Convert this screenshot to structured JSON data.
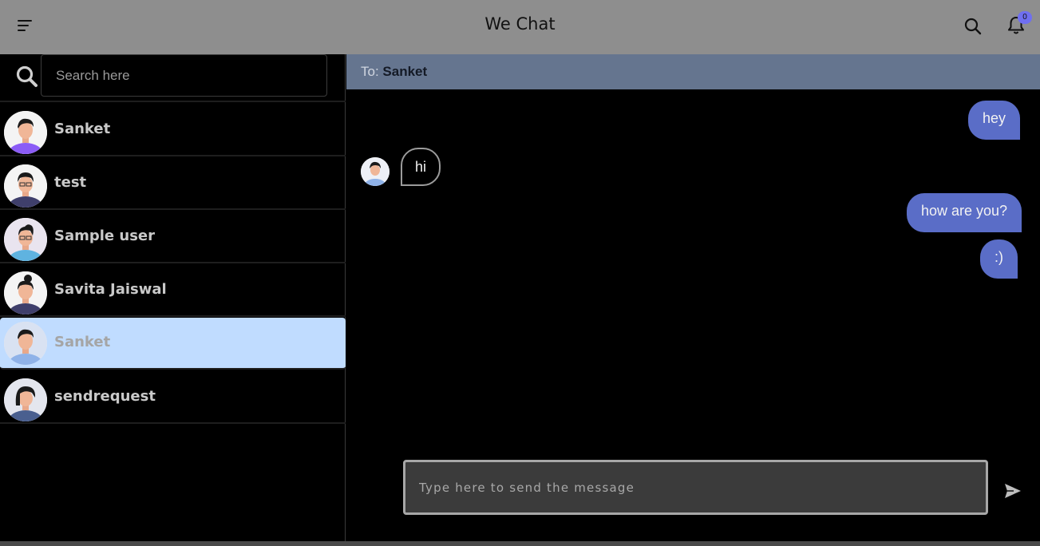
{
  "header": {
    "title": "We Chat",
    "notification_count": "0",
    "accent": "#6f6ff0"
  },
  "sidebar": {
    "search_placeholder": "Search here",
    "contacts": [
      {
        "name": "Sanket",
        "active": false
      },
      {
        "name": "test",
        "active": false
      },
      {
        "name": "Sample user",
        "active": false
      },
      {
        "name": "Savita Jaiswal",
        "active": false
      },
      {
        "name": "Sanket",
        "active": true
      },
      {
        "name": "sendrequest",
        "active": false
      }
    ]
  },
  "chat": {
    "to_label": "To:",
    "to_name": "Sanket",
    "messages": [
      {
        "direction": "out",
        "text": "hey"
      },
      {
        "direction": "in",
        "text": "hi"
      },
      {
        "direction": "out",
        "text": "how are you?"
      },
      {
        "direction": "out",
        "text": ":)"
      }
    ],
    "composer_placeholder": "Type here to send the message"
  },
  "colors": {
    "topbar": "#8e8e8e",
    "chat_header": "#65758f",
    "outgoing_bubble": "#5a6dc7",
    "active_contact": "#c0dcff"
  }
}
